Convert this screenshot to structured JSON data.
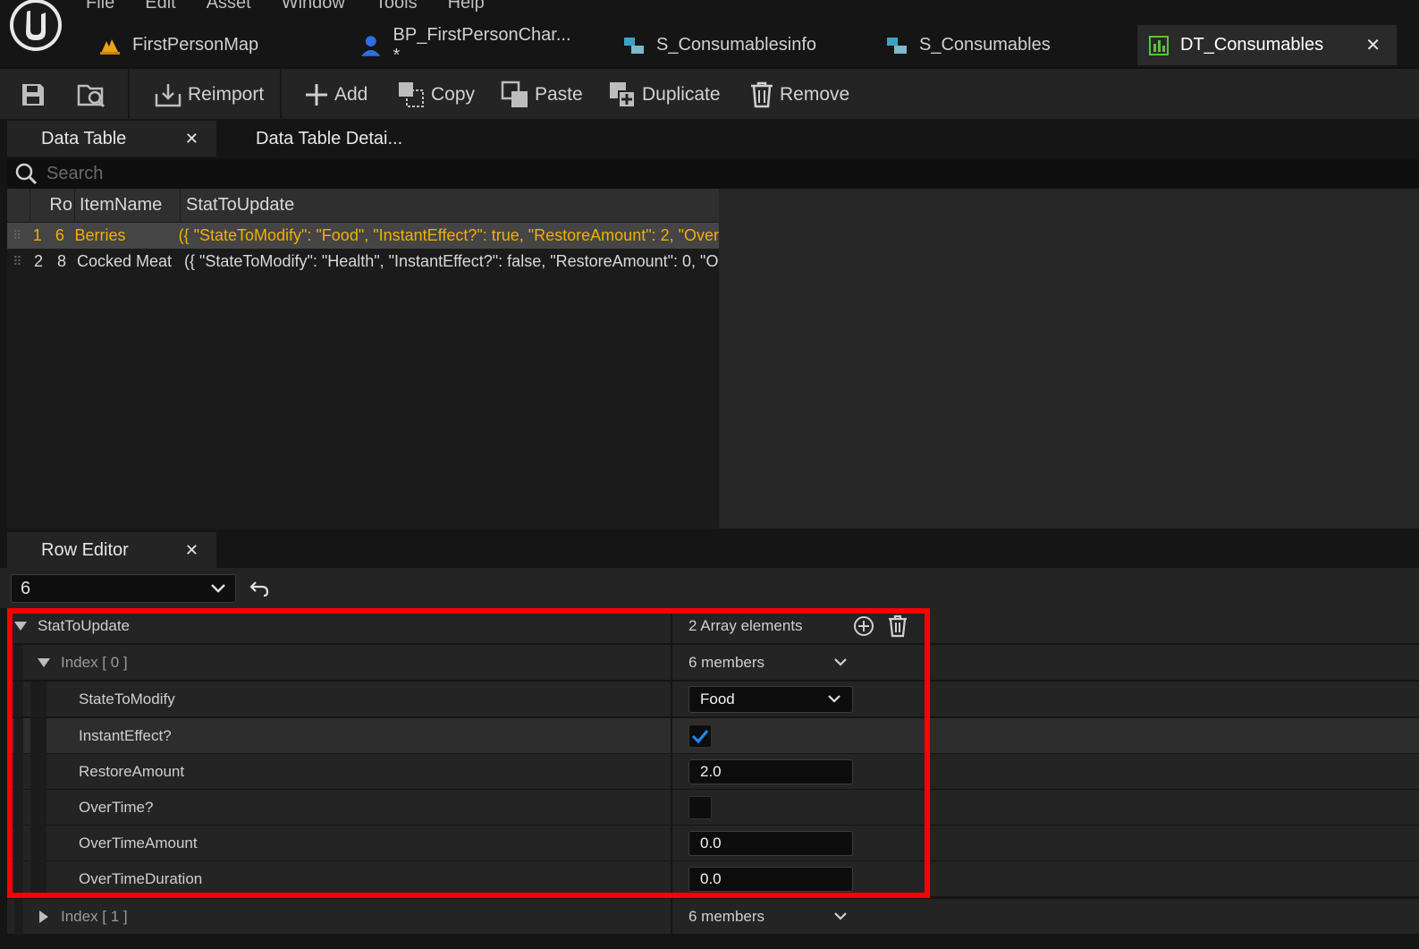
{
  "menu": [
    "File",
    "Edit",
    "Asset",
    "Window",
    "Tools",
    "Help"
  ],
  "doc_tabs": [
    {
      "label": "FirstPersonMap",
      "icon": "map-icon"
    },
    {
      "label": "BP_FirstPersonChar... *",
      "icon": "character-icon"
    },
    {
      "label": "S_Consumablesinfo",
      "icon": "struct-icon"
    },
    {
      "label": "S_Consumables",
      "icon": "struct-icon"
    },
    {
      "label": "DT_Consumables",
      "icon": "datatable-icon",
      "active": true
    }
  ],
  "toolbar": {
    "reimport": "Reimport",
    "add": "Add",
    "copy": "Copy",
    "paste": "Paste",
    "duplicate": "Duplicate",
    "remove": "Remove"
  },
  "panel_tabs": {
    "data_table": "Data Table",
    "data_table_details": "Data Table Detai..."
  },
  "search": {
    "placeholder": "Search"
  },
  "table": {
    "headers": [
      "Ro",
      "ItemName",
      "StatToUpdate"
    ],
    "rows": [
      {
        "index": "1",
        "row_name": "6",
        "item_name": "Berries",
        "stat": "({ \"StateToModify\": \"Food\", \"InstantEffect?\": true, \"RestoreAmount\": 2, \"Over",
        "selected": true
      },
      {
        "index": "2",
        "row_name": "8",
        "item_name": "Cocked Meat",
        "stat": "({ \"StateToModify\": \"Health\", \"InstantEffect?\": false, \"RestoreAmount\": 0, \"O",
        "selected": false
      }
    ]
  },
  "row_editor": {
    "tab": "Row Editor",
    "selected_row": "6",
    "group": {
      "name": "StatToUpdate",
      "value": "2 Array elements"
    },
    "index0": {
      "name": "Index [ 0 ]",
      "value": "6 members"
    },
    "fields": {
      "state_to_modify": {
        "label": "StateToModify",
        "value": "Food"
      },
      "instant_effect": {
        "label": "InstantEffect?",
        "checked": true
      },
      "restore_amount": {
        "label": "RestoreAmount",
        "value": "2.0"
      },
      "over_time": {
        "label": "OverTime?",
        "checked": false
      },
      "over_time_amount": {
        "label": "OverTimeAmount",
        "value": "0.0"
      },
      "over_time_duration": {
        "label": "OverTimeDuration",
        "value": "0.0"
      }
    },
    "index1": {
      "name": "Index [ 1 ]",
      "value": "6 members"
    }
  },
  "colors": {
    "selection_text": "#f0b000",
    "checkbox_accent": "#1e8bff",
    "highlight_border": "#ff0000"
  }
}
